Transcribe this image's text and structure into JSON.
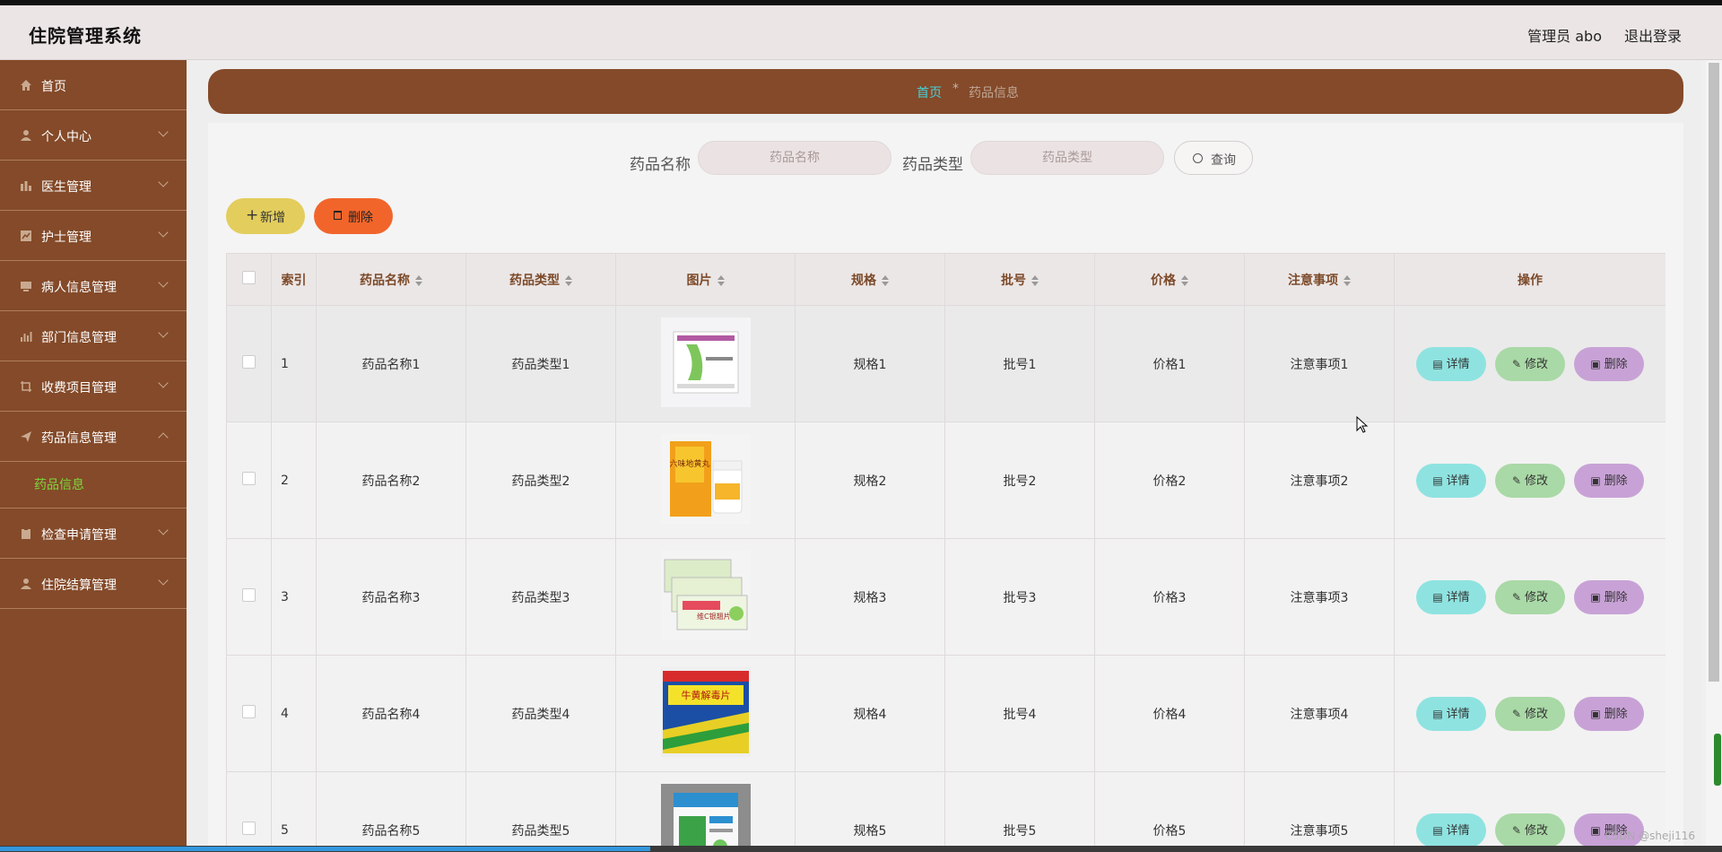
{
  "header": {
    "title": "住院管理系统",
    "admin": "管理员 abo",
    "logout": "退出登录"
  },
  "sidebar": {
    "items": [
      {
        "label": "首页",
        "icon": "home-icon"
      },
      {
        "label": "个人中心",
        "icon": "user-icon"
      },
      {
        "label": "医生管理",
        "icon": "bar-icon"
      },
      {
        "label": "护士管理",
        "icon": "chart-icon"
      },
      {
        "label": "病人信息管理",
        "icon": "monitor-icon"
      },
      {
        "label": "部门信息管理",
        "icon": "bars-icon"
      },
      {
        "label": "收费项目管理",
        "icon": "crop-icon"
      },
      {
        "label": "药品信息管理",
        "icon": "send-icon"
      },
      {
        "label": "检查申请管理",
        "icon": "clipboard-icon"
      },
      {
        "label": "住院结算管理",
        "icon": "user-icon"
      }
    ],
    "submenu_active": "药品信息"
  },
  "breadcrumb": {
    "home": "首页",
    "sep": "*",
    "current": "药品信息"
  },
  "search": {
    "name_label": "药品名称",
    "name_placeholder": "药品名称",
    "type_label": "药品类型",
    "type_placeholder": "药品类型",
    "button": "查询"
  },
  "actions": {
    "add": "新增",
    "delete": "删除"
  },
  "table": {
    "headers": [
      "索引",
      "药品名称",
      "药品类型",
      "图片",
      "规格",
      "批号",
      "价格",
      "注意事项",
      "操作"
    ],
    "rows": [
      {
        "idx": "1",
        "name": "药品名称1",
        "type": "药品类型1",
        "spec": "规格1",
        "batch": "批号1",
        "price": "价格1",
        "note": "注意事项1"
      },
      {
        "idx": "2",
        "name": "药品名称2",
        "type": "药品类型2",
        "spec": "规格2",
        "batch": "批号2",
        "price": "价格2",
        "note": "注意事项2"
      },
      {
        "idx": "3",
        "name": "药品名称3",
        "type": "药品类型3",
        "spec": "规格3",
        "batch": "批号3",
        "price": "价格3",
        "note": "注意事项3"
      },
      {
        "idx": "4",
        "name": "药品名称4",
        "type": "药品类型4",
        "spec": "规格4",
        "batch": "批号4",
        "price": "价格4",
        "note": "注意事项4"
      },
      {
        "idx": "5",
        "name": "药品名称5",
        "type": "药品类型5",
        "spec": "规格5",
        "batch": "批号5",
        "price": "价格5",
        "note": "注意事项5"
      }
    ],
    "row_actions": {
      "detail": "详情",
      "edit": "修改",
      "delete": "删除"
    }
  },
  "thumb_texts": [
    "六味地黄丸",
    "维C银翘片",
    "牛黄解毒片"
  ],
  "watermark": "CSDN @sheji116",
  "colors": {
    "sidebar": "#844a29",
    "active_sub": "#7bd83c",
    "breadcrumb_home": "#47d0d8",
    "add": "#e3cd5c",
    "delete": "#f1652b",
    "detail": "#8ee3e0",
    "edit": "#a9d9a6",
    "row_delete": "#c8a2d6"
  }
}
